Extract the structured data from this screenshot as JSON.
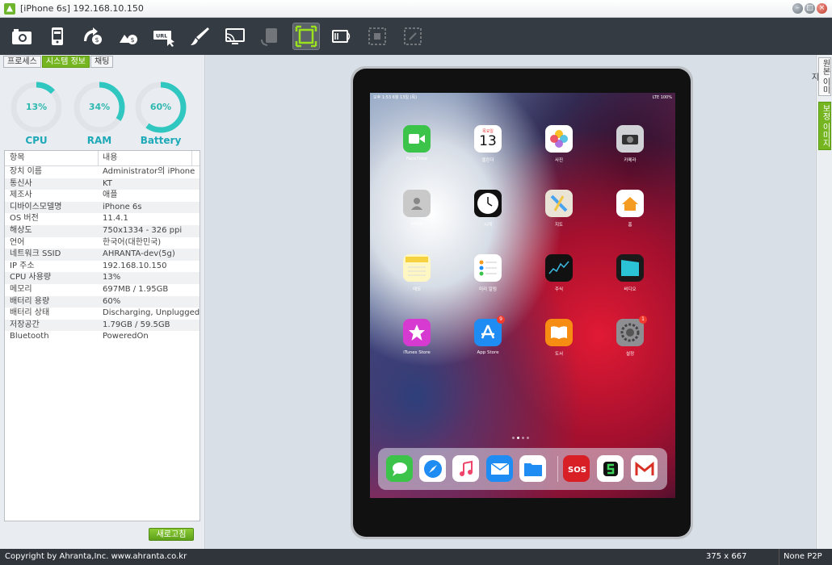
{
  "window": {
    "title": "[iPhone 6s] 192.168.10.150"
  },
  "toolbar": {
    "buttons": [
      "screenshot-camera",
      "device-phone",
      "remote-capture-1",
      "remote-capture-2",
      "url-keyboard",
      "brush",
      "screen-mirror",
      "rotate",
      "fit-screen",
      "fullscreen",
      "crop-1",
      "crop-2"
    ]
  },
  "left": {
    "tabs": [
      "프로세스",
      "시스템 정보",
      "채팅"
    ],
    "gauges": [
      {
        "label": "CPU",
        "value": "13%",
        "percent": 0.13
      },
      {
        "label": "RAM",
        "value": "34%",
        "percent": 0.34
      },
      {
        "label": "Battery",
        "value": "60%",
        "percent": 0.6
      }
    ],
    "table": {
      "headers": [
        "항목",
        "내용"
      ],
      "rows": [
        [
          "장치 이름",
          "Administrator의 iPhone"
        ],
        [
          "통신사",
          "KT"
        ],
        [
          "제조사",
          "애플"
        ],
        [
          "디바이스모델명",
          "iPhone 6s"
        ],
        [
          "OS 버전",
          "11.4.1"
        ],
        [
          "해상도",
          "750x1334 - 326 ppi"
        ],
        [
          "언어",
          "한국어(대한민국)"
        ],
        [
          "네트워크 SSID",
          "AHRANTA-dev(5g)"
        ],
        [
          "IP 주소",
          "192.168.10.150"
        ],
        [
          "CPU 사용량",
          "13%"
        ],
        [
          "메모리",
          "697MB / 1.95GB"
        ],
        [
          "배터리 용량",
          "60%"
        ],
        [
          "배터리 상태",
          "Discharging, Unplugged"
        ],
        [
          "저장공간",
          "1.79GB / 59.5GB"
        ],
        [
          "Bluetooth",
          "PoweredOn"
        ]
      ]
    },
    "refresh_label": "새로고침"
  },
  "side_tabs": [
    "원본 이미지",
    "보정 이미지"
  ],
  "device": {
    "status_left": "오후 1:53  6월 13일 (목)",
    "status_right": "LTE 100%",
    "calendar": {
      "weekday": "목요일",
      "day": "13"
    },
    "apps": [
      {
        "label": "FaceTime",
        "icon": "facetime-icon",
        "color": "#3cc34a"
      },
      {
        "label": "캘린더",
        "icon": "calendar-icon",
        "color": "#ffffff"
      },
      {
        "label": "사진",
        "icon": "photos-icon",
        "color": "#ffffff"
      },
      {
        "label": "카메라",
        "icon": "camera-icon",
        "color": "#d0d2d6"
      },
      {
        "label": "연락처",
        "icon": "contacts-icon",
        "color": "#c9c9c9"
      },
      {
        "label": "시계",
        "icon": "clock-icon",
        "color": "#111111"
      },
      {
        "label": "지도",
        "icon": "maps-icon",
        "color": "#e9e4d6"
      },
      {
        "label": "홈",
        "icon": "home-icon",
        "color": "#ffffff"
      },
      {
        "label": "메모",
        "icon": "notes-icon",
        "color": "#fff7c2"
      },
      {
        "label": "미리 알림",
        "icon": "reminders-icon",
        "color": "#ffffff"
      },
      {
        "label": "주식",
        "icon": "stocks-icon",
        "color": "#111111"
      },
      {
        "label": "비디오",
        "icon": "videos-icon",
        "color": "#1a1a1a"
      },
      {
        "label": "iTunes Store",
        "icon": "itunes-store-icon",
        "color": "#d63ad1"
      },
      {
        "label": "App Store",
        "icon": "app-store-icon",
        "color": "#1e8cf3",
        "badge": "9"
      },
      {
        "label": "도서",
        "icon": "books-icon",
        "color": "#f78c13"
      },
      {
        "label": "설정",
        "icon": "settings-icon",
        "color": "#8e8e93",
        "badge": "1"
      }
    ],
    "dock": [
      {
        "icon": "messages-icon",
        "color": "#3cc34a"
      },
      {
        "icon": "safari-icon",
        "color": "#ffffff"
      },
      {
        "icon": "music-icon",
        "color": "#ffffff"
      },
      {
        "icon": "mail-icon",
        "color": "#1e8cf3"
      },
      {
        "icon": "files-icon",
        "color": "#ffffff"
      },
      {
        "icon": "sos-icon",
        "color": "#d81f26"
      },
      {
        "icon": "s-app-icon",
        "color": "#ffffff"
      },
      {
        "icon": "gmail-icon",
        "color": "#ffffff"
      }
    ]
  },
  "statusbar": {
    "copyright": "Copyright by Ahranta,Inc. www.ahranta.co.kr",
    "resolution": "375 x 667",
    "connection": "None P2P"
  }
}
